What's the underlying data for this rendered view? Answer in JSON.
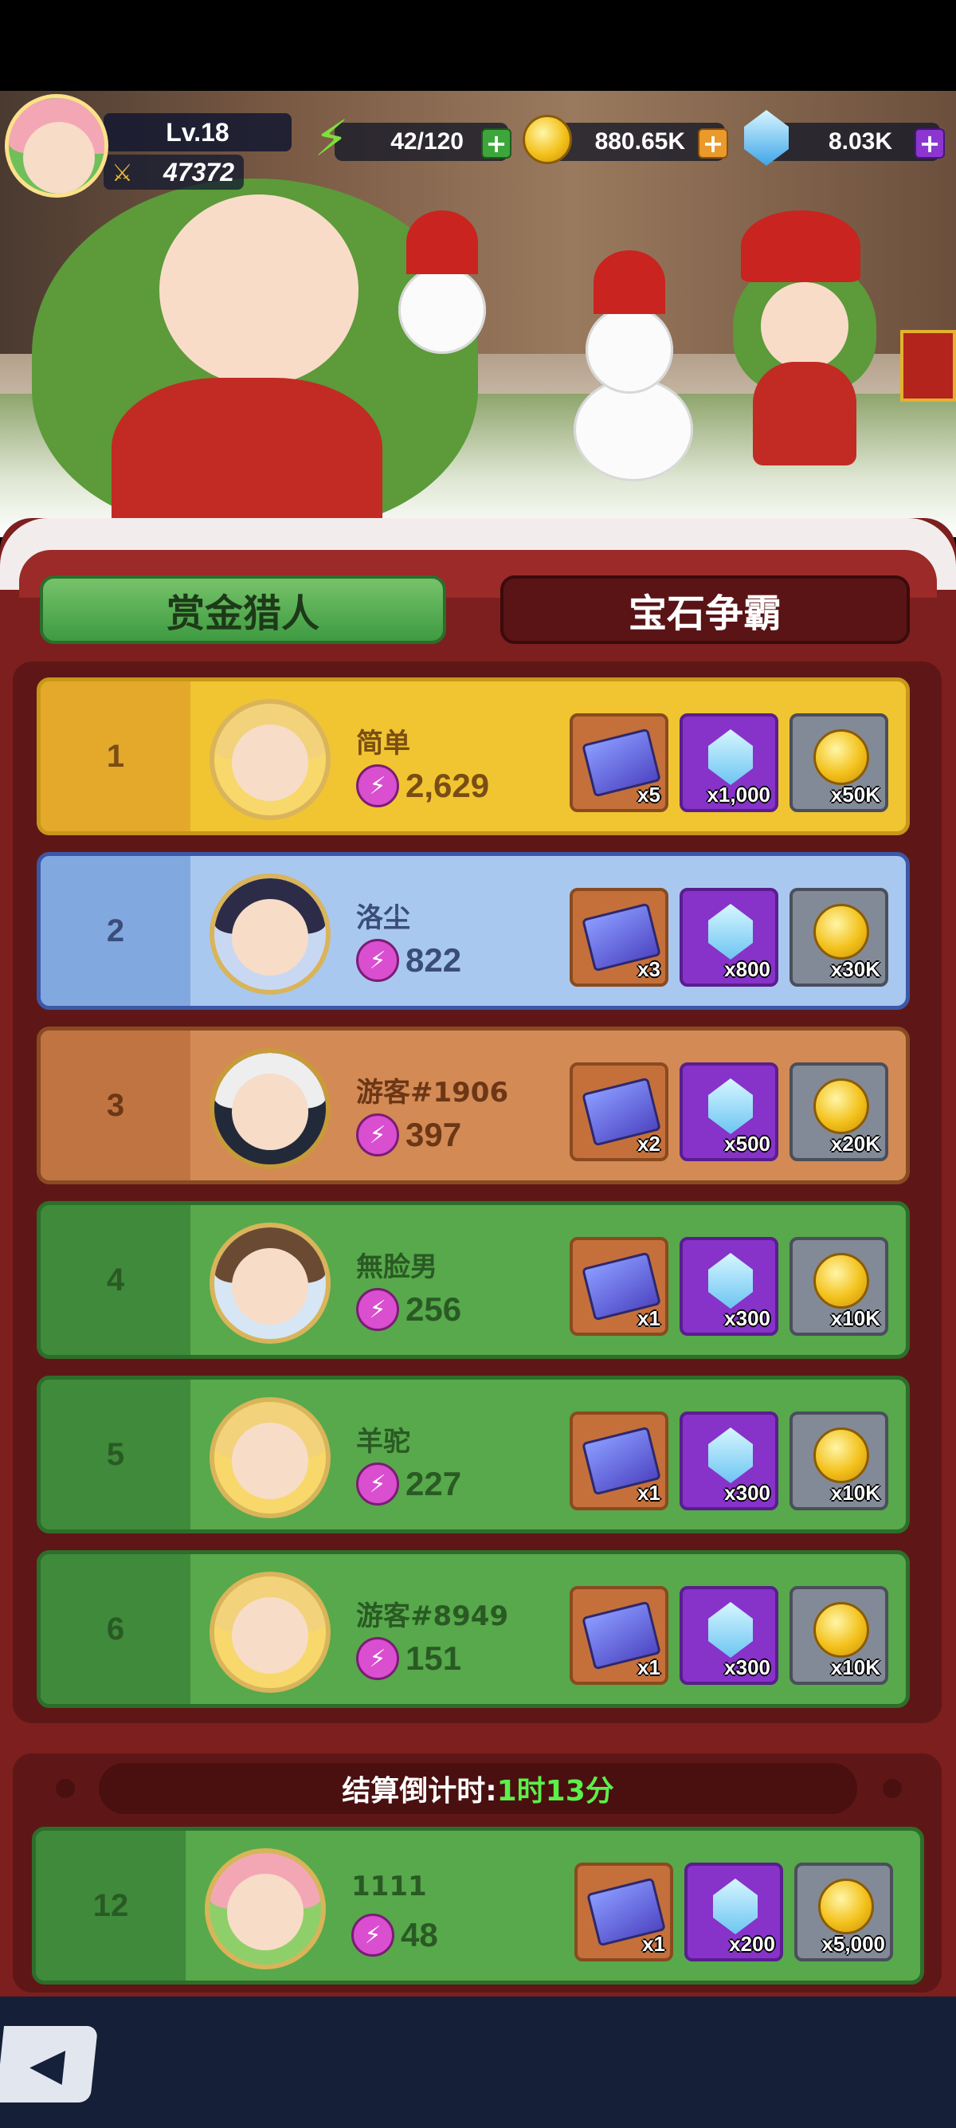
{
  "header": {
    "level": "Lv.18",
    "power": "47372",
    "energy": "42/120",
    "gold": "880.65K",
    "gems": "8.03K"
  },
  "tabs": [
    {
      "label": "赏金猎人",
      "active": true
    },
    {
      "label": "宝石争霸",
      "active": false
    }
  ],
  "leaderboard": [
    {
      "rank": "1",
      "name": "简单",
      "score": "2,629",
      "tickets": "x5",
      "gems": "x1,000",
      "gold": "x50K"
    },
    {
      "rank": "2",
      "name": "洛尘",
      "score": "822",
      "tickets": "x3",
      "gems": "x800",
      "gold": "x30K"
    },
    {
      "rank": "3",
      "name": "游客#1906",
      "score": "397",
      "tickets": "x2",
      "gems": "x500",
      "gold": "x20K"
    },
    {
      "rank": "4",
      "name": "無脸男",
      "score": "256",
      "tickets": "x1",
      "gems": "x300",
      "gold": "x10K"
    },
    {
      "rank": "5",
      "name": "羊驼",
      "score": "227",
      "tickets": "x1",
      "gems": "x300",
      "gold": "x10K"
    },
    {
      "rank": "6",
      "name": "游客#8949",
      "score": "151",
      "tickets": "x1",
      "gems": "x300",
      "gold": "x10K"
    }
  ],
  "countdown": {
    "label": "结算倒计时:",
    "value": "1时13分"
  },
  "my_rank": {
    "rank": "12",
    "name": "1111",
    "score": "48",
    "tickets": "x1",
    "gems": "x200",
    "gold": "x5,000"
  },
  "colors": {
    "gold_row": "#f0c531",
    "silver_row": "#a9c8f0",
    "bronze_row": "#d38a55",
    "green_row": "#57a94b",
    "panel": "#7c1f1e",
    "countdown_highlight": "#5bf04a"
  }
}
